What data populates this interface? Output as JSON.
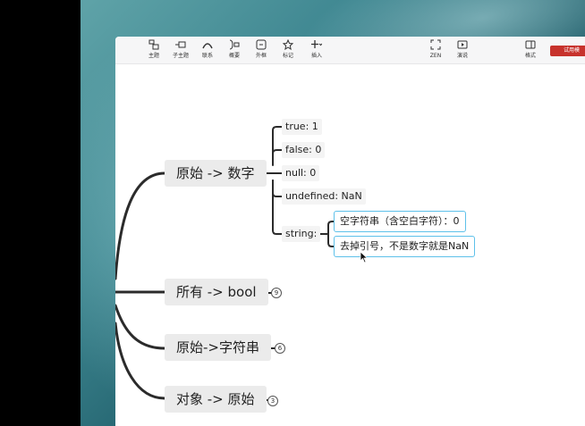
{
  "toolbar": {
    "items": [
      {
        "label": "主题",
        "icon": "topic-icon"
      },
      {
        "label": "子主题",
        "icon": "subtopic-icon"
      },
      {
        "label": "联系",
        "icon": "relationship-icon"
      },
      {
        "label": "概要",
        "icon": "summary-icon"
      },
      {
        "label": "外框",
        "icon": "boundary-icon"
      },
      {
        "label": "标记",
        "icon": "star-icon"
      },
      {
        "label": "插入",
        "icon": "insert-plus-icon"
      },
      {
        "label": "ZEN",
        "icon": "zen-icon"
      },
      {
        "label": "演说",
        "icon": "pitch-icon"
      },
      {
        "label": "格式",
        "icon": "format-panel-icon"
      }
    ],
    "trial_label": "试用模"
  },
  "mindmap": {
    "topics": [
      {
        "label": "原始 -> 数字"
      },
      {
        "label": "所有 -> bool",
        "count": "9"
      },
      {
        "label": "原始->字符串",
        "count": "6"
      },
      {
        "label": "对象 -> 原始",
        "count": "3"
      }
    ],
    "number_children": [
      {
        "label": "true: 1"
      },
      {
        "label": "false: 0"
      },
      {
        "label": "null: 0"
      },
      {
        "label": "undefined: NaN"
      },
      {
        "label": "string:"
      }
    ],
    "string_children": [
      {
        "label": "空字符串（含空白字符）：0"
      },
      {
        "label": "去掉引号，不是数字就是NaN"
      }
    ]
  },
  "colors": {
    "accent_selection": "#5ec1ea",
    "trial_button": "#c7322c",
    "branch_line": "#2b2b2b"
  }
}
